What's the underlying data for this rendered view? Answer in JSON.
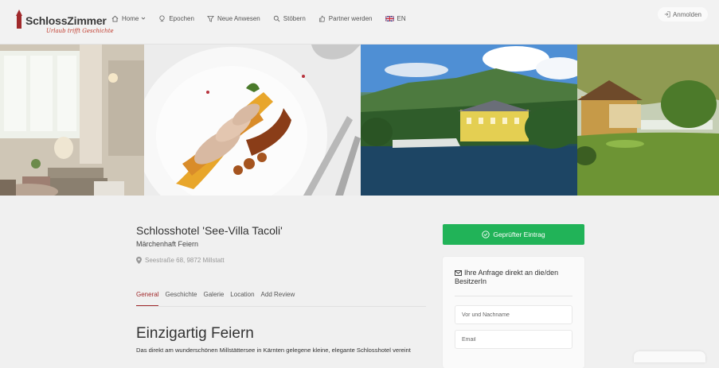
{
  "brand": {
    "name": "SchlossZimmer",
    "tagline": "Urlaub trifft Geschichte"
  },
  "nav": {
    "items": [
      {
        "label": "Home",
        "icon": "home-icon",
        "dropdown": true
      },
      {
        "label": "Epochen",
        "icon": "epochs-icon"
      },
      {
        "label": "Neue Anwesen",
        "icon": "filter-icon"
      },
      {
        "label": "Stöbern",
        "icon": "search-icon"
      },
      {
        "label": "Partner werden",
        "icon": "thumbs-up-icon"
      },
      {
        "label": "EN",
        "icon": "uk-flag-icon"
      }
    ],
    "login_label": "Anmolden"
  },
  "listing": {
    "title": "Schlosshotel 'See-Villa Tacoli'",
    "subtitle": "Märchenhaft Feiern",
    "address": "Seestraße 68, 9872 Millstatt",
    "tabs": [
      "General",
      "Geschichte",
      "Galerie",
      "Location",
      "Add Review"
    ],
    "active_tab": "General",
    "heading": "Einzigartig Feiern",
    "intro": "Das direkt am wunderschönen Millstättersee in Kärnten gelegene kleine, elegante Schlosshotel vereint"
  },
  "sidebar": {
    "verified_label": "Geprüfter Eintrag",
    "form_title": "Ihre Anfrage direkt an die/den BesitzerIn",
    "name_placeholder": "Vor und Nachname",
    "email_placeholder": "Email"
  },
  "colors": {
    "accent": "#a0292b",
    "verified": "#21b358",
    "header_bg": "#f2f2f2",
    "page_bg": "#f0f0f0"
  }
}
